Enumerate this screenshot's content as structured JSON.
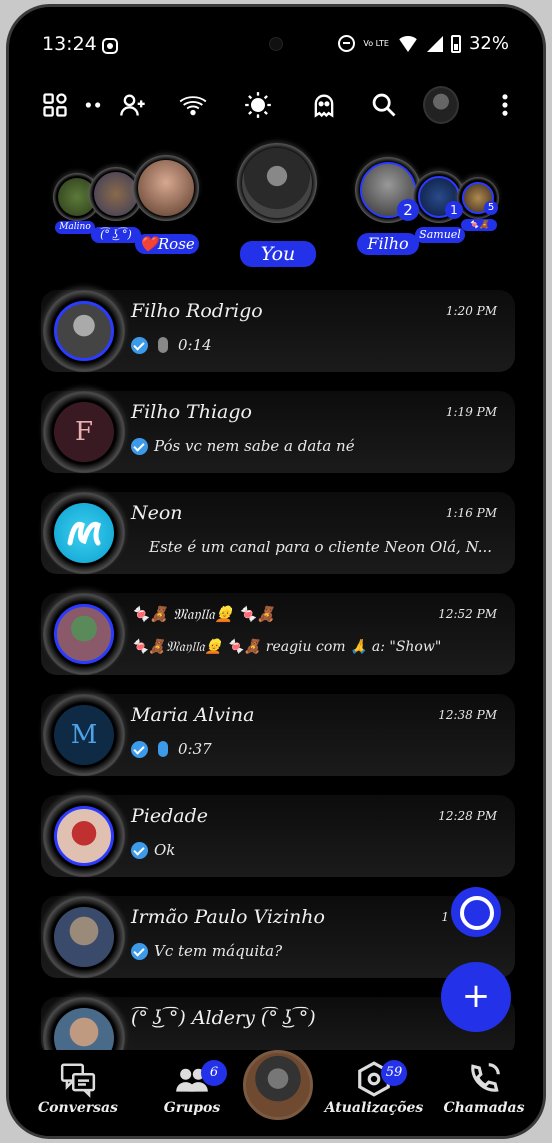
{
  "status_bar": {
    "time": "13:24",
    "battery": "32%",
    "network": "Vo LTE"
  },
  "toolbar": {
    "icons": [
      "apps-icon",
      "more-dots-icon",
      "add-contact-icon",
      "wifi-icon",
      "brightness-icon",
      "ghost-icon",
      "search-icon",
      "profile-avatar",
      "overflow-menu-icon"
    ]
  },
  "stories": {
    "left_names": [
      "Malino",
      "(͡° ͜ʖ ͡°)",
      "❤️Rose"
    ],
    "center_label": "You",
    "right_names": [
      "Filho",
      "Samuel",
      "🍬🧸"
    ],
    "right_badges": [
      "2",
      "1",
      "5"
    ]
  },
  "chats": [
    {
      "name": "Filho Rodrigo",
      "time": "1:20 PM",
      "preview": "0:14",
      "type": "voice"
    },
    {
      "name": "Filho Thiago",
      "time": "1:19 PM",
      "preview": "Pós vc nem sabe a data né",
      "type": "text",
      "initial": "F"
    },
    {
      "name": "Neon",
      "time": "1:16 PM",
      "preview": "Este é um canal para o cliente Neon     Olá, N...",
      "type": "channel"
    },
    {
      "name": "🍬🧸 𝔐𝔞𝔶𝔩𝔩𝔞👱 🍬🧸",
      "time": "12:52 PM",
      "preview": "🍬🧸𝔐𝔞𝔶𝔩𝔩𝔞👱 🍬🧸 reagiu com 🙏 a: \"Show\"",
      "type": "reaction"
    },
    {
      "name": "Maria Alvina",
      "time": "12:38 PM",
      "preview": "0:37",
      "type": "voice",
      "initial": "M"
    },
    {
      "name": "Piedade",
      "time": "12:28 PM",
      "preview": "Ok",
      "type": "text"
    },
    {
      "name": "Irmão Paulo Vizinho",
      "time": "1",
      "preview": "Vc tem máquita?",
      "type": "text"
    },
    {
      "name": "(͡° ͜ʖ ͡°) Aldery (͡° ͜ʖ ͡°)",
      "time": "",
      "preview": "",
      "type": "text"
    }
  ],
  "bottom_nav": {
    "items": [
      {
        "label": "Conversas"
      },
      {
        "label": "Grupos",
        "badge": "6"
      },
      {
        "label": "Atualizações",
        "badge": "59"
      },
      {
        "label": "Chamadas"
      }
    ]
  },
  "colors": {
    "accent": "#2332e8",
    "tick": "#3d9ae8",
    "background": "#000000"
  }
}
